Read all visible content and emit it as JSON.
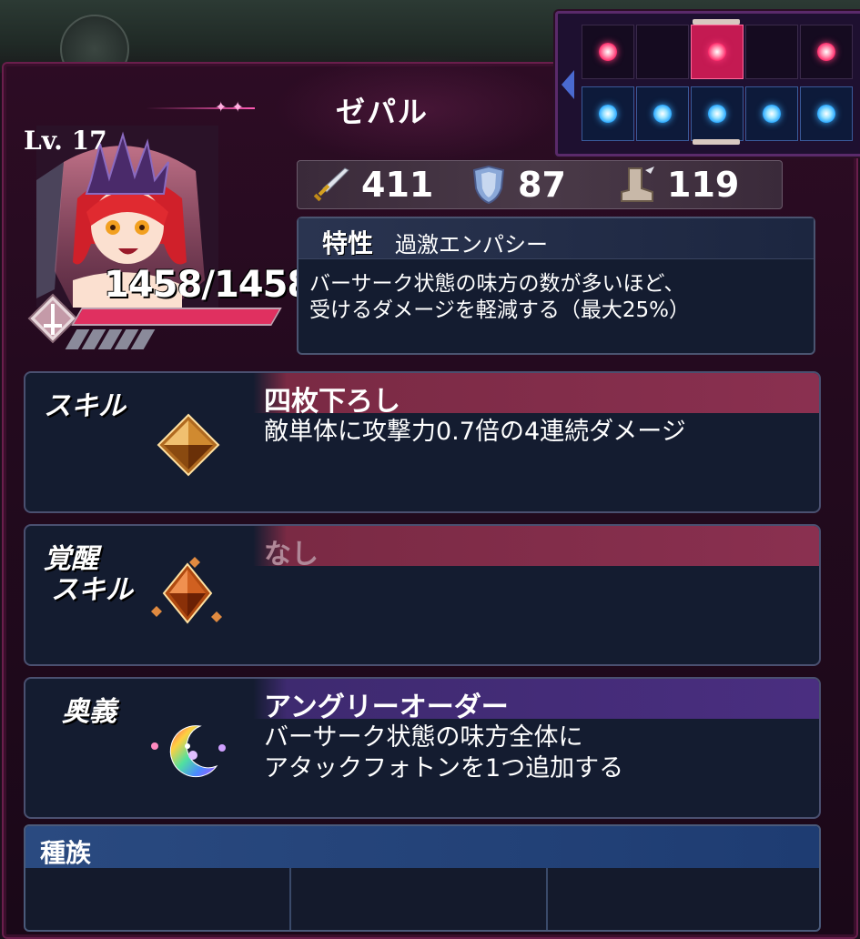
{
  "character": {
    "name": "ゼパル",
    "level": "Lv. 17",
    "hp": "1458/1458",
    "hp_ratio": 1.0
  },
  "stats": {
    "attack": "411",
    "defense": "87",
    "speed": "119",
    "attack_icon": "sword-icon",
    "defense_icon": "shield-icon",
    "speed_icon": "boot-icon"
  },
  "photons": {
    "top_row": [
      "red",
      "empty",
      "red-highlighted",
      "empty",
      "red"
    ],
    "bottom_row": [
      "blue",
      "blue",
      "blue",
      "blue",
      "blue"
    ]
  },
  "trait": {
    "label": "特性",
    "name": "過激エンパシー",
    "description_line1": "バーサーク状態の味方の数が多いほど、",
    "description_line2": "受けるダメージを軽減する（最大25%）"
  },
  "skill": {
    "label": "スキル",
    "name": "四枚下ろし",
    "description": "敵単体に攻撃力0.7倍の4連続ダメージ",
    "icon": "gem-icon"
  },
  "awakened_skill": {
    "label_line1": "覚醒",
    "label_line2": "スキル",
    "name": "なし",
    "icon": "awakened-gem-icon"
  },
  "ougi": {
    "label": "奥義",
    "name": "アングリーオーダー",
    "description_line1": "バーサーク状態の味方全体に",
    "description_line2": "アタックフォトンを1つ追加する",
    "icon": "moon-icon"
  },
  "race": {
    "title": "種族",
    "entries": [
      "",
      "",
      ""
    ]
  },
  "colors": {
    "skill_header": "#8a3050",
    "ougi_header": "#4a2e80",
    "race_header": "#1e3c72",
    "hp_bar": "#e03060"
  }
}
